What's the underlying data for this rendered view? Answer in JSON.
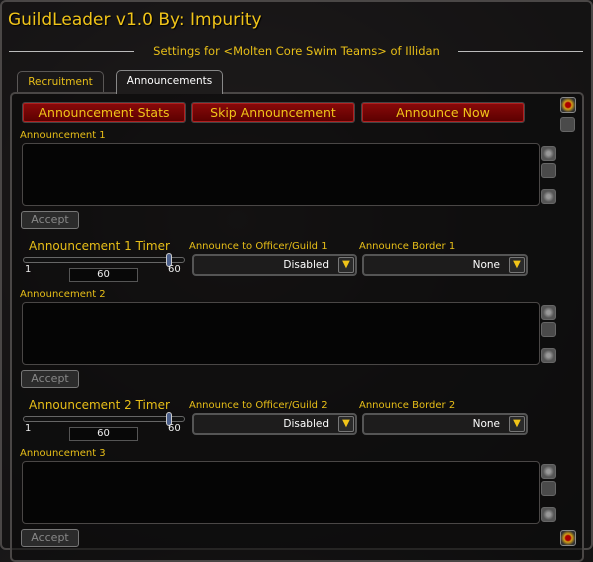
{
  "window": {
    "title": "GuildLeader v1.0 By: Impurity",
    "subtitle": "Settings for <Molten Core Swim Teams> of Illidan"
  },
  "tabs": [
    {
      "label": "Recruitment",
      "active": false
    },
    {
      "label": "Announcements",
      "active": true
    }
  ],
  "toolbar": {
    "stats": "Announcement Stats",
    "skip": "Skip Announcement",
    "now": "Announce Now"
  },
  "announcements": [
    {
      "label": "Announcement 1",
      "text": "",
      "accept": "Accept",
      "timer_label": "Announcement 1 Timer",
      "timer_min": "1",
      "timer_max": "60",
      "timer_value": "60",
      "channel_label": "Announce to Officer/Guild 1",
      "channel_value": "Disabled",
      "border_label": "Announce Border 1",
      "border_value": "None"
    },
    {
      "label": "Announcement 2",
      "text": "",
      "accept": "Accept",
      "timer_label": "Announcement 2 Timer",
      "timer_min": "1",
      "timer_max": "60",
      "timer_value": "60",
      "channel_label": "Announce to Officer/Guild 2",
      "channel_value": "Disabled",
      "border_label": "Announce Border 2",
      "border_value": "None"
    },
    {
      "label": "Announcement 3",
      "text": "",
      "accept": "Accept"
    }
  ],
  "colors": {
    "accent": "#f0c419",
    "button_red": "#7a0606"
  }
}
